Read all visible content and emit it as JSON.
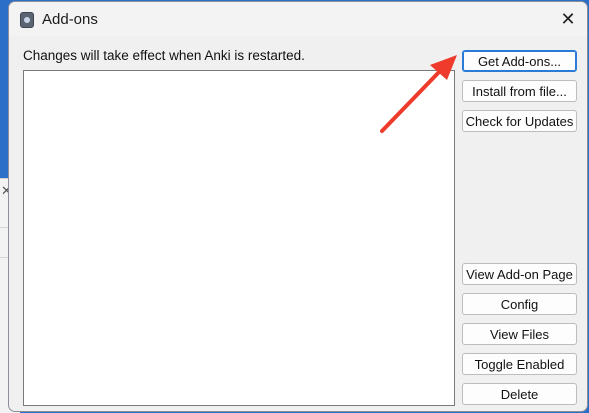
{
  "dialog": {
    "title": "Add-ons",
    "close_glyph": "✕"
  },
  "hint": "Changes will take effect when Anki is restarted.",
  "buttons": {
    "get_addons": "Get Add-ons...",
    "install_from_file": "Install from file...",
    "check_updates": "Check for Updates",
    "view_page": "View Add-on Page",
    "config": "Config",
    "view_files": "View Files",
    "toggle_enabled": "Toggle Enabled",
    "delete": "Delete"
  },
  "background": {
    "close_glyph": "✕"
  },
  "colors": {
    "annotation_arrow": "#ee3b2c",
    "focus_border": "#2a7bd8"
  }
}
